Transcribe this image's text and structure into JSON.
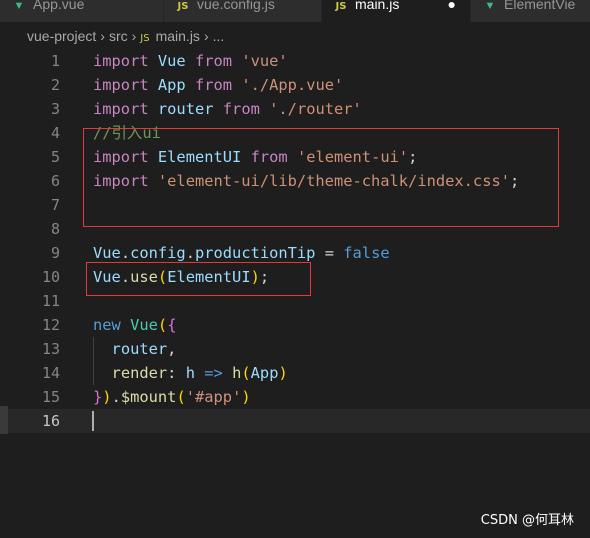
{
  "tabs": [
    {
      "label": "App.vue",
      "icon": "vue-icon",
      "active": false
    },
    {
      "label": "vue.config.js",
      "icon": "js-icon",
      "active": false
    },
    {
      "label": "main.js",
      "icon": "js-icon",
      "active": true,
      "modified": true
    },
    {
      "label": "ElementVie",
      "icon": "vue-icon",
      "active": false
    }
  ],
  "icons": {
    "vue": "▼",
    "js": "JS",
    "modified_dot": "●"
  },
  "breadcrumb": {
    "items": [
      "vue-project",
      "src",
      "main.js",
      "..."
    ],
    "sep": "›"
  },
  "editor": {
    "lines": [
      {
        "n": "1",
        "tokens": [
          [
            "imp",
            "import"
          ],
          [
            "plain",
            " "
          ],
          [
            "var",
            "Vue"
          ],
          [
            "plain",
            " "
          ],
          [
            "imp",
            "from"
          ],
          [
            "plain",
            " "
          ],
          [
            "str",
            "'vue'"
          ]
        ]
      },
      {
        "n": "2",
        "tokens": [
          [
            "imp",
            "import"
          ],
          [
            "plain",
            " "
          ],
          [
            "var",
            "App"
          ],
          [
            "plain",
            " "
          ],
          [
            "imp",
            "from"
          ],
          [
            "plain",
            " "
          ],
          [
            "str",
            "'./App.vue'"
          ]
        ]
      },
      {
        "n": "3",
        "tokens": [
          [
            "imp",
            "import"
          ],
          [
            "plain",
            " "
          ],
          [
            "var",
            "router"
          ],
          [
            "plain",
            " "
          ],
          [
            "imp",
            "from"
          ],
          [
            "plain",
            " "
          ],
          [
            "str",
            "'./router'"
          ]
        ]
      },
      {
        "n": "4",
        "tokens": [
          [
            "cmt",
            "//引入ui"
          ]
        ]
      },
      {
        "n": "5",
        "tokens": [
          [
            "imp",
            "import"
          ],
          [
            "plain",
            " "
          ],
          [
            "var",
            "ElementUI"
          ],
          [
            "plain",
            " "
          ],
          [
            "imp",
            "from"
          ],
          [
            "plain",
            " "
          ],
          [
            "str",
            "'element-ui'"
          ],
          [
            "plain",
            ";"
          ]
        ]
      },
      {
        "n": "6",
        "tokens": [
          [
            "imp",
            "import"
          ],
          [
            "plain",
            " "
          ],
          [
            "str",
            "'element-ui/lib/theme-chalk/index.css'"
          ],
          [
            "plain",
            ";"
          ]
        ]
      },
      {
        "n": "7",
        "tokens": []
      },
      {
        "n": "8",
        "tokens": []
      },
      {
        "n": "9",
        "tokens": [
          [
            "var",
            "Vue"
          ],
          [
            "plain",
            "."
          ],
          [
            "var",
            "config"
          ],
          [
            "plain",
            "."
          ],
          [
            "var",
            "productionTip"
          ],
          [
            "plain",
            " = "
          ],
          [
            "kw",
            "false"
          ]
        ]
      },
      {
        "n": "10",
        "tokens": [
          [
            "var",
            "Vue"
          ],
          [
            "plain",
            "."
          ],
          [
            "fn",
            "use"
          ],
          [
            "br1",
            "("
          ],
          [
            "var",
            "ElementUI"
          ],
          [
            "br1",
            ")"
          ],
          [
            "plain",
            ";"
          ]
        ]
      },
      {
        "n": "11",
        "tokens": []
      },
      {
        "n": "12",
        "tokens": [
          [
            "kw",
            "new"
          ],
          [
            "plain",
            " "
          ],
          [
            "cls",
            "Vue"
          ],
          [
            "br1",
            "("
          ],
          [
            "br2",
            "{"
          ]
        ]
      },
      {
        "n": "13",
        "tokens": [
          [
            "plain",
            "  "
          ],
          [
            "var",
            "router"
          ],
          [
            "plain",
            ","
          ]
        ]
      },
      {
        "n": "14",
        "tokens": [
          [
            "plain",
            "  "
          ],
          [
            "fn",
            "render"
          ],
          [
            "plain",
            ": "
          ],
          [
            "var",
            "h"
          ],
          [
            "plain",
            " "
          ],
          [
            "kw",
            "=>"
          ],
          [
            "plain",
            " "
          ],
          [
            "fn",
            "h"
          ],
          [
            "br1",
            "("
          ],
          [
            "var",
            "App"
          ],
          [
            "br1",
            ")"
          ]
        ]
      },
      {
        "n": "15",
        "tokens": [
          [
            "br2",
            "}"
          ],
          [
            "br1",
            ")"
          ],
          [
            "plain",
            "."
          ],
          [
            "fn",
            "$mount"
          ],
          [
            "br1",
            "("
          ],
          [
            "str",
            "'#app'"
          ],
          [
            "br1",
            ")"
          ]
        ]
      },
      {
        "n": "16",
        "tokens": [],
        "current": true
      }
    ]
  },
  "watermark": "CSDN @何耳林"
}
